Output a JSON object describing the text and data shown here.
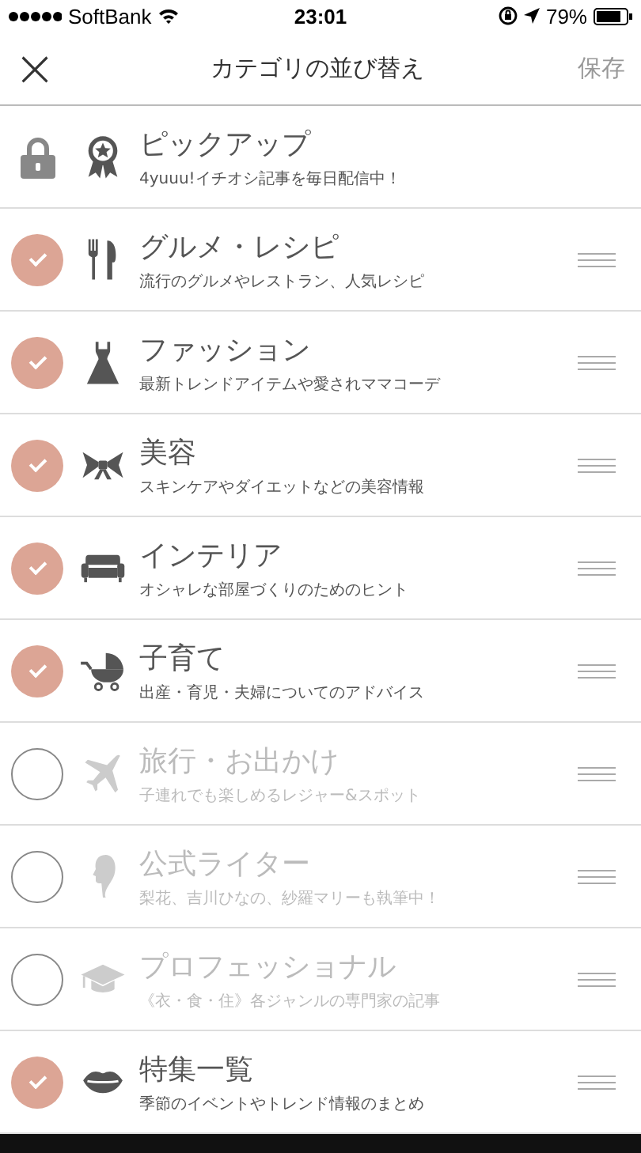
{
  "status_bar": {
    "carrier": "SoftBank",
    "time": "23:01",
    "battery": "79%"
  },
  "nav": {
    "close": "×",
    "title": "カテゴリの並び替え",
    "save": "保存"
  },
  "categories": [
    {
      "kind": "locked",
      "title": "ピックアップ",
      "subtitle": "4yuuu!イチオシ記事を毎日配信中！"
    },
    {
      "kind": "category",
      "checked": true,
      "title": "グルメ・レシピ",
      "subtitle": "流行のグルメやレストラン、人気レシピ"
    },
    {
      "kind": "category",
      "checked": true,
      "title": "ファッション",
      "subtitle": "最新トレンドアイテムや愛されママコーデ"
    },
    {
      "kind": "category",
      "checked": true,
      "title": "美容",
      "subtitle": "スキンケアやダイエットなどの美容情報"
    },
    {
      "kind": "category",
      "checked": true,
      "title": "インテリア",
      "subtitle": "オシャレな部屋づくりのためのヒント"
    },
    {
      "kind": "category",
      "checked": true,
      "title": "子育て",
      "subtitle": "出産・育児・夫婦についてのアドバイス"
    },
    {
      "kind": "category",
      "checked": false,
      "title": "旅行・お出かけ",
      "subtitle": "子連れでも楽しめるレジャー&スポット"
    },
    {
      "kind": "category",
      "checked": false,
      "title": "公式ライター",
      "subtitle": "梨花、吉川ひなの、紗羅マリーも執筆中！"
    },
    {
      "kind": "category",
      "checked": false,
      "title": "プロフェッショナル",
      "subtitle": "《衣・食・住》各ジャンルの専門家の記事"
    },
    {
      "kind": "category",
      "checked": true,
      "title": "特集一覧",
      "subtitle": "季節のイベントやトレンド情報のまとめ"
    }
  ]
}
